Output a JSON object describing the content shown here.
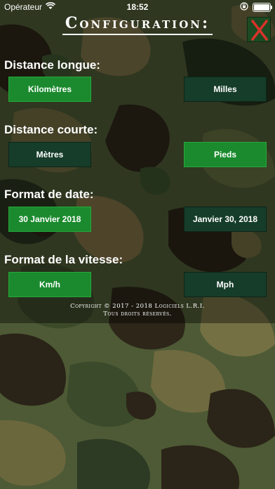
{
  "status_bar": {
    "carrier": "Opérateur",
    "time": "18:52"
  },
  "header": {
    "title": "Configuration:",
    "close_label": "X"
  },
  "sections": [
    {
      "label": "Distance longue:",
      "options": [
        {
          "label": "Kilomètres",
          "selected": true
        },
        {
          "label": "Milles",
          "selected": false
        }
      ]
    },
    {
      "label": "Distance courte:",
      "options": [
        {
          "label": "Mètres",
          "selected": false
        },
        {
          "label": "Pieds",
          "selected": true
        }
      ]
    },
    {
      "label": "Format de date:",
      "options": [
        {
          "label": "30 Janvier 2018",
          "selected": true
        },
        {
          "label": "Janvier 30, 2018",
          "selected": false
        }
      ]
    },
    {
      "label": "Format de la vitesse:",
      "options": [
        {
          "label": "Km/h",
          "selected": true
        },
        {
          "label": "Mph",
          "selected": false
        }
      ]
    }
  ],
  "footer": {
    "copyright_line1": "Copyright © 2017 - 2018 Logiciels L.R.I.",
    "copyright_line2": "Tous droits réservés."
  },
  "colors": {
    "selected": "#1b8a2e",
    "unselected": "#163d2a",
    "close_x": "#d8332a"
  },
  "icons": [
    "wifi-icon",
    "lock-rotation-icon",
    "battery-icon",
    "close-icon"
  ]
}
